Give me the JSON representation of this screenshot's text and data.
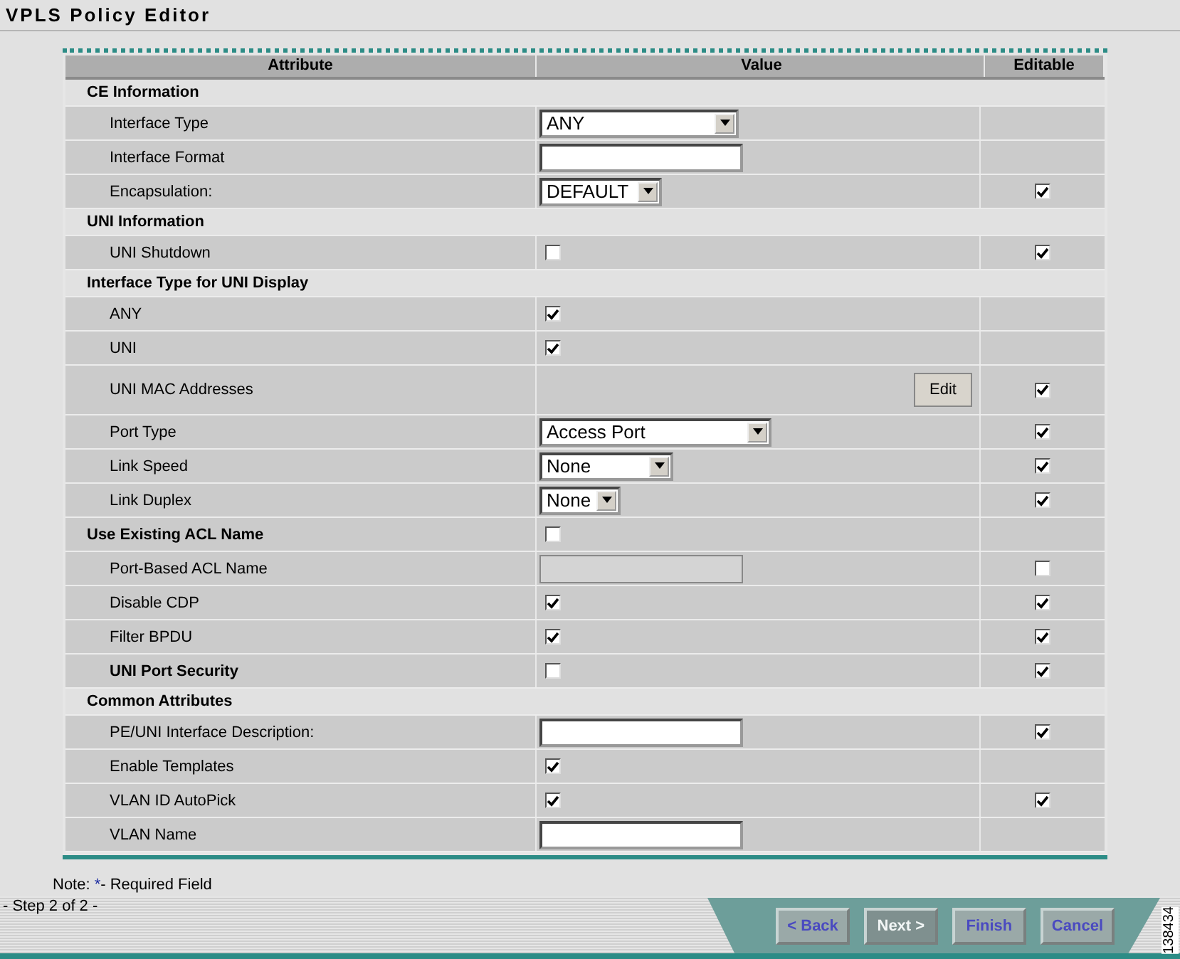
{
  "title": "VPLS Policy Editor",
  "columns": [
    "Attribute",
    "Value",
    "Editable"
  ],
  "rows": [
    {
      "kind": "section",
      "label": "CE Information"
    },
    {
      "kind": "attribute",
      "label": "Interface Type",
      "value": {
        "kind": "select",
        "text": "ANY"
      }
    },
    {
      "kind": "attribute",
      "label": "Interface Format",
      "value": {
        "kind": "text"
      }
    },
    {
      "kind": "attribute",
      "label": "Encapsulation:",
      "value": {
        "kind": "select",
        "text": "DEFAULT"
      },
      "editable": true
    },
    {
      "kind": "section",
      "label": "UNI Information"
    },
    {
      "kind": "attribute",
      "label": "UNI Shutdown",
      "value": {
        "kind": "checkbox",
        "checked": false
      },
      "editable": true
    },
    {
      "kind": "section",
      "label": "Interface Type for UNI Display"
    },
    {
      "kind": "attribute",
      "label": "ANY",
      "value": {
        "kind": "checkbox",
        "checked": true
      }
    },
    {
      "kind": "attribute",
      "label": "UNI",
      "value": {
        "kind": "checkbox",
        "checked": true
      }
    },
    {
      "kind": "attribute",
      "label": "UNI MAC Addresses",
      "value": {
        "kind": "button",
        "text": "Edit"
      },
      "editable": true
    },
    {
      "kind": "attribute",
      "label": "Port Type",
      "value": {
        "kind": "select",
        "text": "Access Port"
      },
      "editable": true
    },
    {
      "kind": "attribute",
      "label": "Link Speed",
      "value": {
        "kind": "select",
        "text": "None"
      },
      "editable": true
    },
    {
      "kind": "attribute",
      "label": "Link Duplex",
      "value": {
        "kind": "select",
        "text": "None"
      },
      "editable": true
    },
    {
      "kind": "group_attribute",
      "label": "Use Existing ACL Name",
      "value": {
        "kind": "checkbox",
        "checked": false
      }
    },
    {
      "kind": "attribute",
      "label": "Port-Based ACL Name",
      "value": {
        "kind": "text",
        "disabled": true
      },
      "editable": false
    },
    {
      "kind": "attribute",
      "label": "Disable CDP",
      "value": {
        "kind": "checkbox",
        "checked": true
      },
      "editable": true
    },
    {
      "kind": "attribute",
      "label": "Filter BPDU",
      "value": {
        "kind": "checkbox",
        "checked": true
      },
      "editable": true
    },
    {
      "kind": "attribute",
      "label": "UNI Port Security",
      "bold": true,
      "value": {
        "kind": "checkbox",
        "checked": false
      },
      "editable": true
    },
    {
      "kind": "section",
      "label": "Common Attributes"
    },
    {
      "kind": "attribute",
      "label": "PE/UNI Interface Description:",
      "value": {
        "kind": "text"
      },
      "editable": true
    },
    {
      "kind": "attribute",
      "label": "Enable Templates",
      "value": {
        "kind": "checkbox",
        "checked": true
      }
    },
    {
      "kind": "attribute",
      "label": "VLAN ID AutoPick",
      "value": {
        "kind": "checkbox",
        "checked": true
      },
      "editable": true
    },
    {
      "kind": "attribute",
      "label": "VLAN Name",
      "value": {
        "kind": "text"
      }
    }
  ],
  "note": {
    "label": "Note:",
    "mark": "*",
    "text": "- Required Field"
  },
  "step": "- Step 2 of 2 -",
  "buttons": [
    {
      "label": "< Back",
      "disabled": false
    },
    {
      "label": "Next >",
      "disabled": true
    },
    {
      "label": "Finish",
      "disabled": false
    },
    {
      "label": "Cancel",
      "disabled": false
    }
  ],
  "figure_id": "138434"
}
